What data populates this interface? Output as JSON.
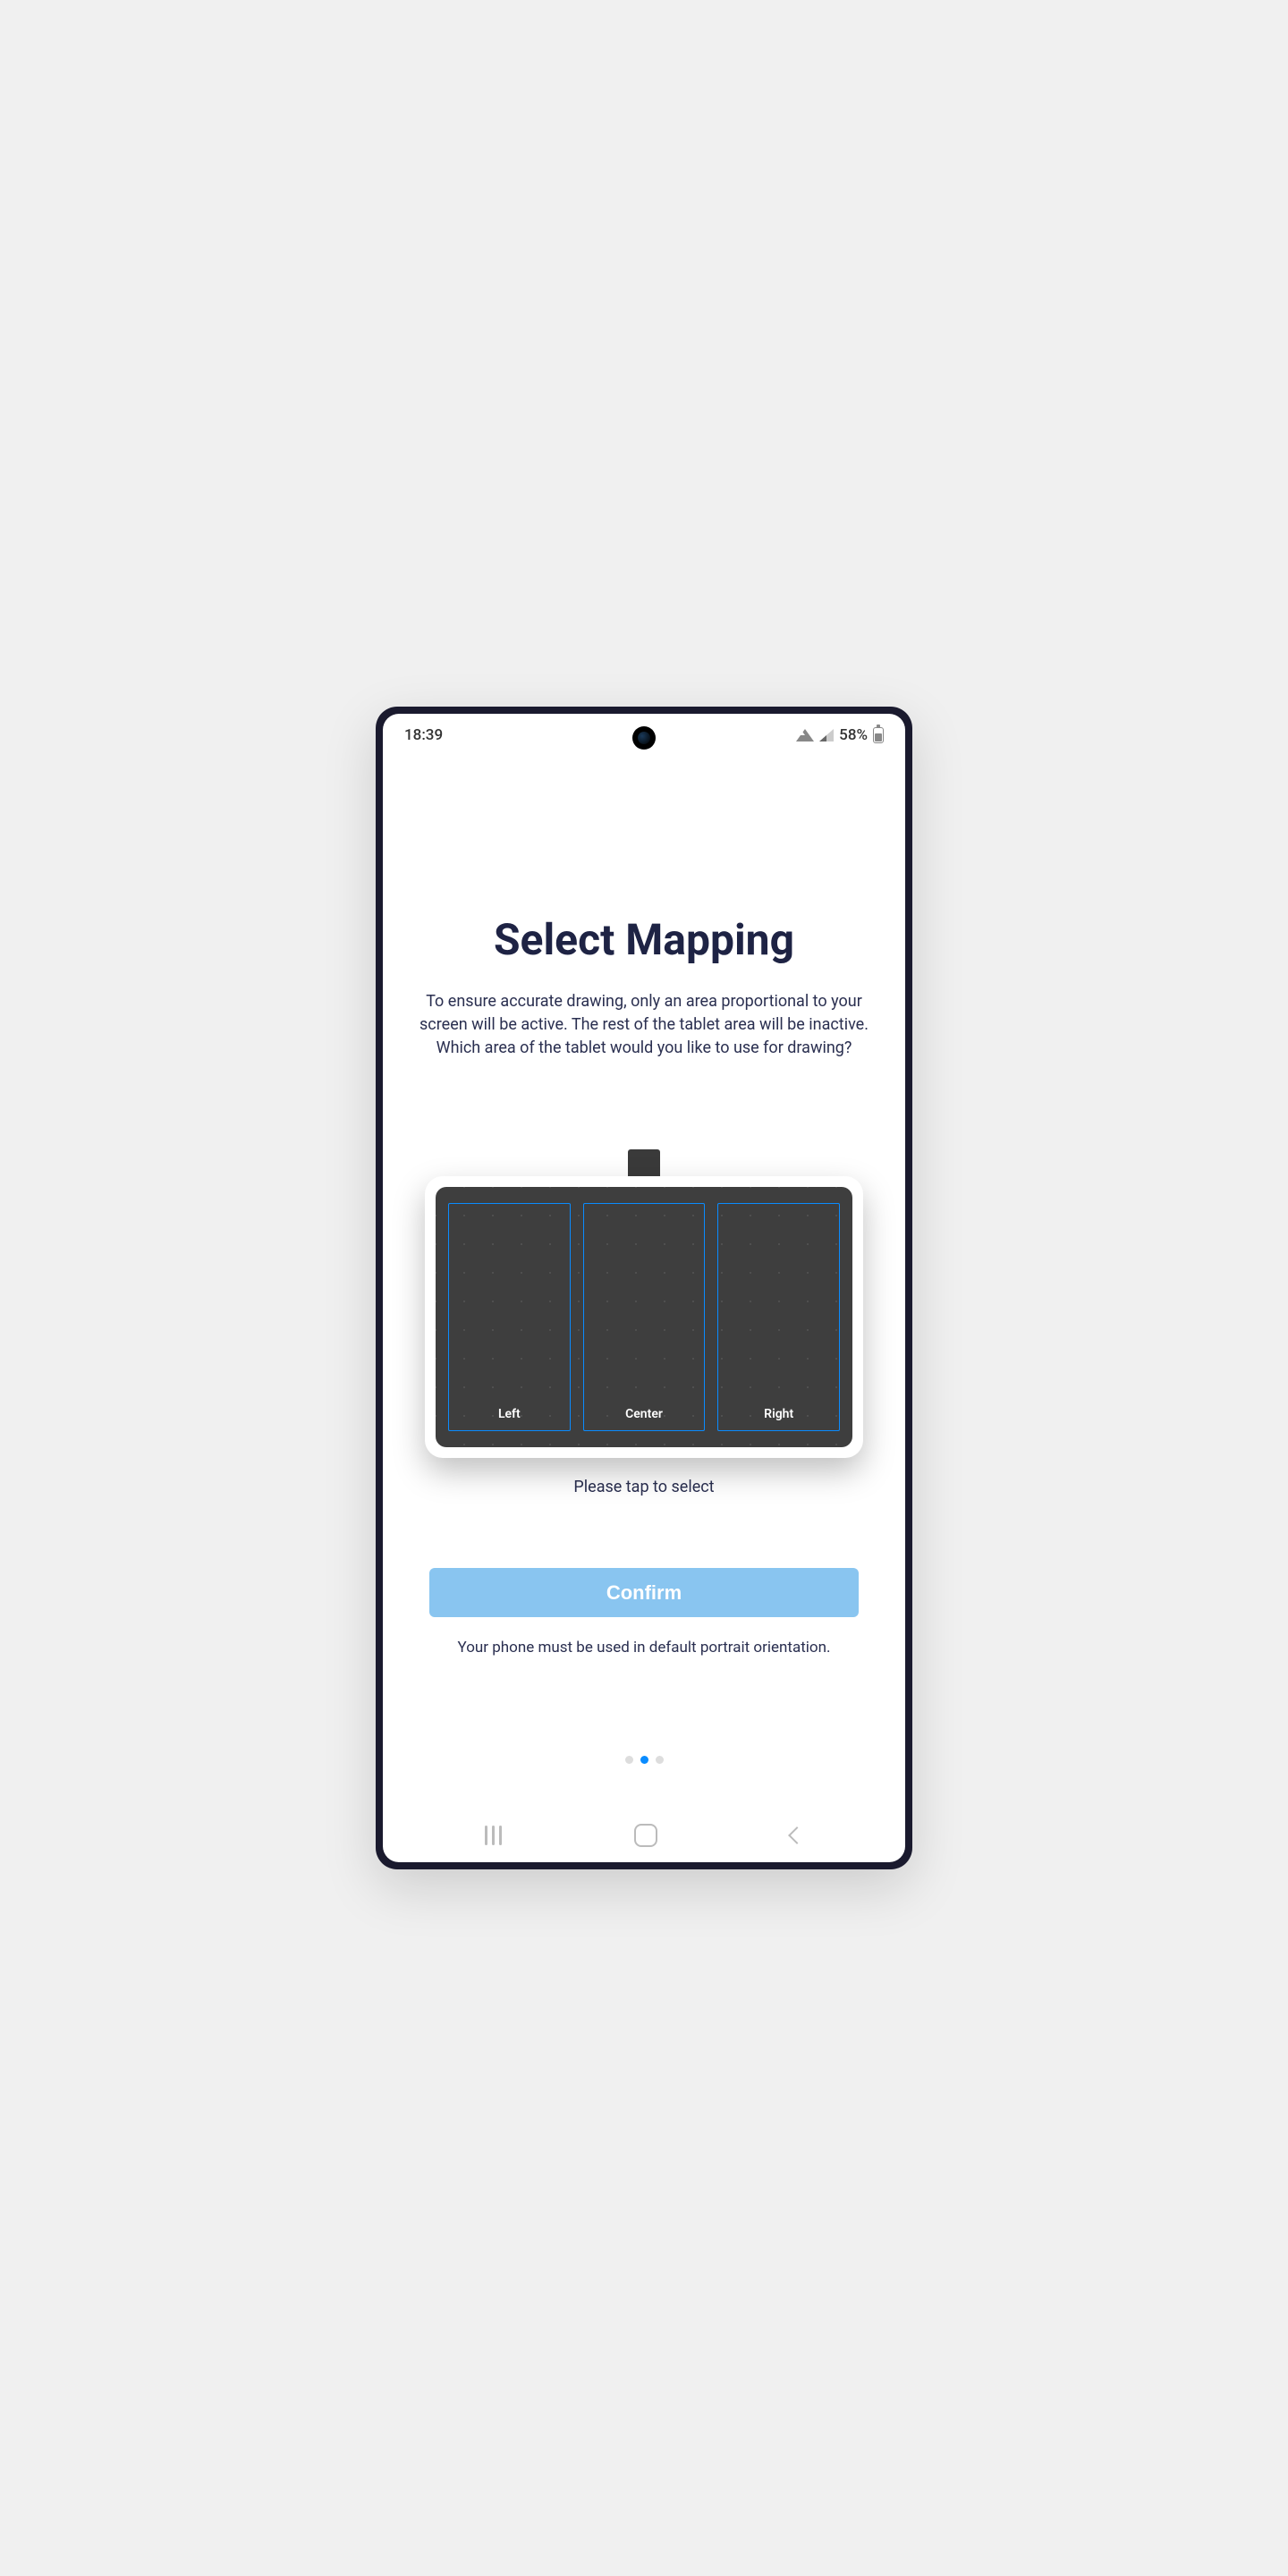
{
  "statusBar": {
    "time": "18:39",
    "batteryPercent": "58%"
  },
  "header": {
    "title": "Select Mapping",
    "description": "To ensure accurate drawing, only an area proportional to your screen will be active. The rest of the tablet area will be inactive. Which area of the tablet would you like to use for drawing?"
  },
  "tablet": {
    "zones": {
      "left": "Left",
      "center": "Center",
      "right": "Right"
    },
    "hint": "Please tap to select"
  },
  "actions": {
    "confirm": "Confirm",
    "note": "Your phone must be used in default portrait orientation."
  },
  "pagination": {
    "total": 3,
    "active": 1
  }
}
